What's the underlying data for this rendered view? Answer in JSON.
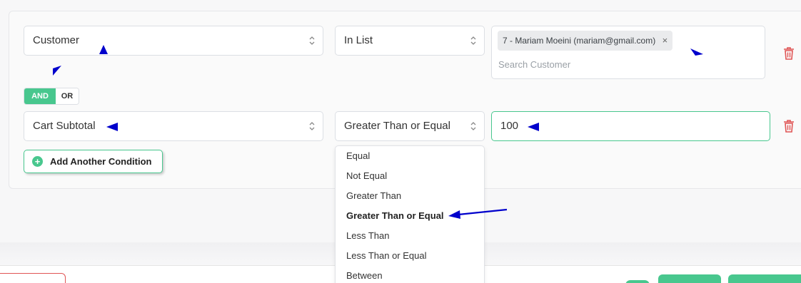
{
  "rows": [
    {
      "field": "Customer",
      "operator": "In List",
      "value_tag": "7 - Mariam Moeini (mariam@gmail.com)",
      "value_tag_remove": "×",
      "value_placeholder": "Search Customer"
    },
    {
      "field": "Cart Subtotal",
      "operator": "Greater Than or Equal",
      "value": "100"
    }
  ],
  "logic": {
    "and": "AND",
    "or": "OR",
    "selected": "AND"
  },
  "add_condition_label": "Add Another Condition",
  "operator_dropdown": {
    "options": [
      "Equal",
      "Not Equal",
      "Greater Than",
      "Greater Than or Equal",
      "Less Than",
      "Less Than or Equal",
      "Between"
    ],
    "selected": "Greater Than or Equal"
  },
  "colors": {
    "accent": "#48c78e",
    "danger": "#e05555",
    "annotation": "#0000cc"
  },
  "icons": [
    "sort-caret-icon",
    "trash-icon",
    "plus-circle-icon",
    "annotation-arrow-icon"
  ]
}
